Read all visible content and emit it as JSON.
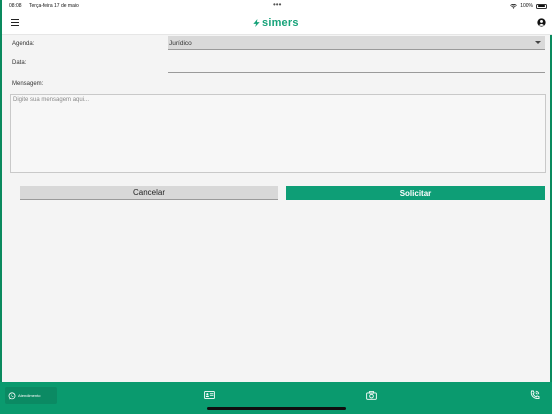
{
  "status_bar": {
    "time": "08:08",
    "date": "Terça-feira 17 de maio",
    "dots": "•••",
    "battery": "100%"
  },
  "header": {
    "logo_text": "simers",
    "brand_color": "#17a37a"
  },
  "form": {
    "agenda_label": "Agenda:",
    "agenda_value": "Jurídico",
    "date_label": "Data:",
    "message_label": "Mensagem:",
    "message_placeholder": "Digite sua mensagem aqui..."
  },
  "buttons": {
    "cancel": "Cancelar",
    "submit": "Solicitar"
  },
  "bottom_bar": {
    "atendimento_label": "Atendimento",
    "icons": [
      "whatsapp-icon",
      "id-card-icon",
      "camera-icon",
      "phone-icon"
    ]
  }
}
